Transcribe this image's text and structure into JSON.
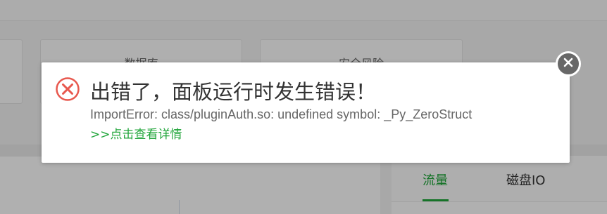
{
  "background": {
    "cards": [
      {
        "title": "数据库"
      },
      {
        "title": "安全风险"
      }
    ],
    "tabs": [
      {
        "label": "流量",
        "active": true
      },
      {
        "label": "磁盘IO",
        "active": false
      }
    ]
  },
  "dialog": {
    "icon": "error-circle-icon",
    "title": "出错了，面板运行时发生错误！",
    "detail": "ImportError: class/pluginAuth.so: undefined symbol: _Py_ZeroStruct",
    "link": ">>点击查看详情",
    "close_icon": "close-icon"
  },
  "colors": {
    "accent": "#20a53a",
    "error": "#e8584e",
    "close_button": "#686868"
  }
}
